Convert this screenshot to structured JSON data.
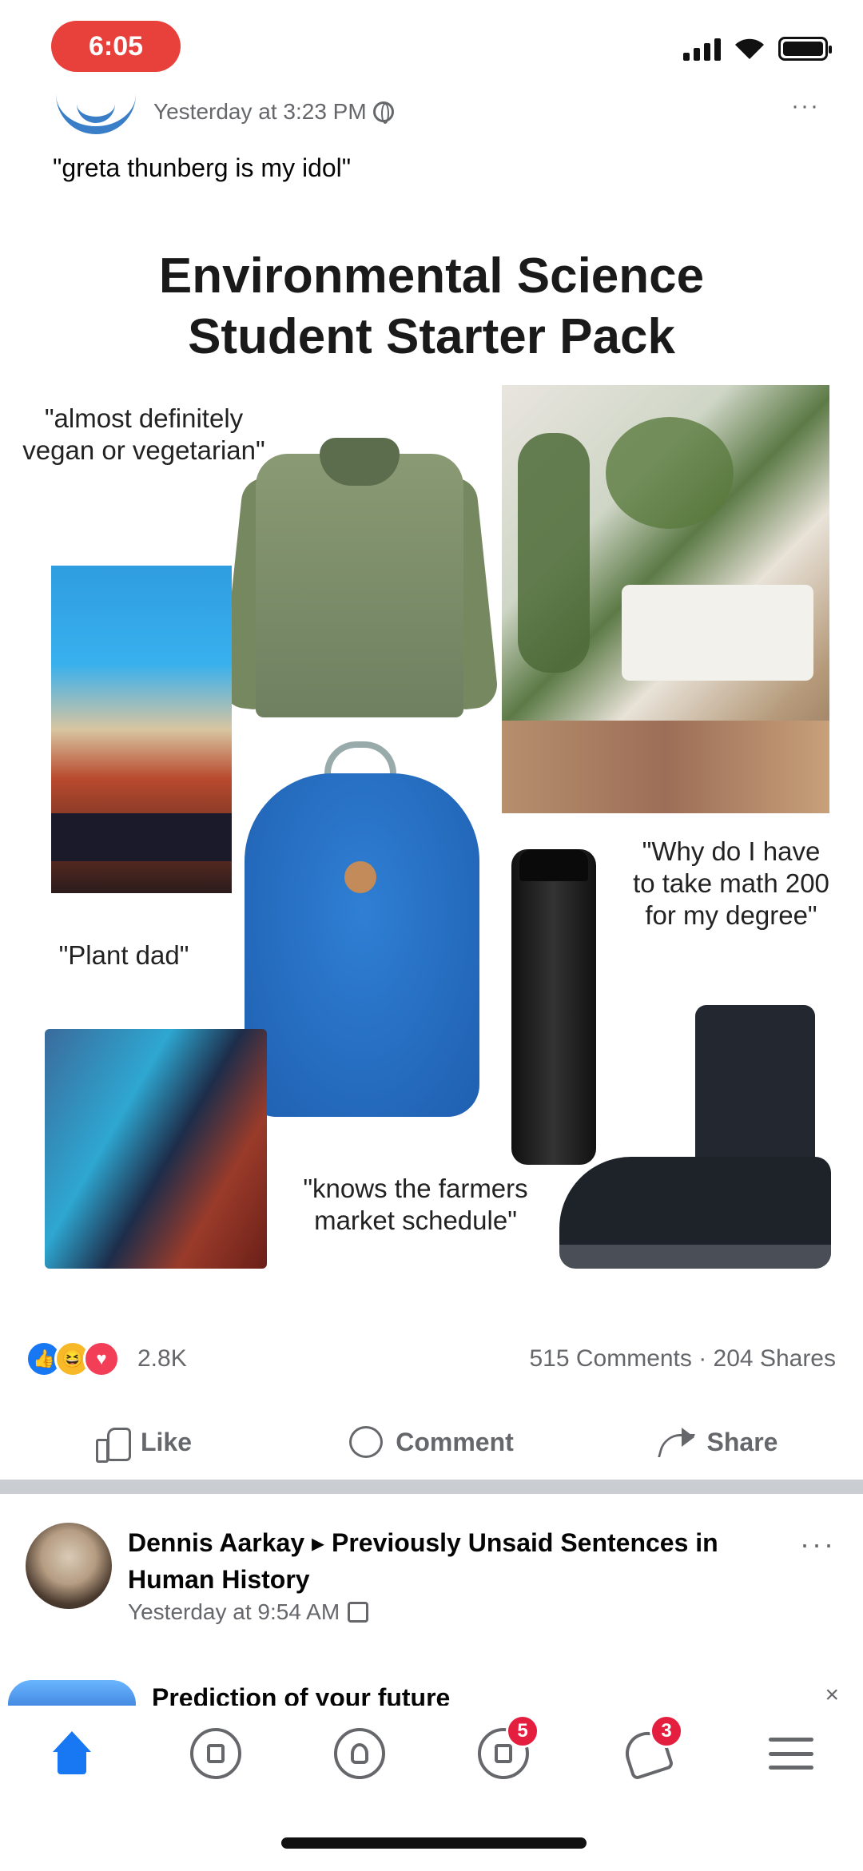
{
  "status_bar": {
    "time": "6:05"
  },
  "post": {
    "timestamp": "Yesterday at 3:23 PM",
    "caption": "\"greta thunberg is my idol\"",
    "more": "···",
    "meme": {
      "title_line1": "Environmental Science",
      "title_line2": "Student Starter Pack",
      "quote_vegan": "\"almost definitely vegan or vegetarian\"",
      "quote_plant": "\"Plant dad\"",
      "quote_math": "\"Why do I have to take math 200 for my degree\"",
      "quote_market": "\"knows the farmers market schedule\""
    },
    "reactions": {
      "count": "2.8K",
      "engagement": "515 Comments · 204 Shares"
    },
    "actions": {
      "like": "Like",
      "comment": "Comment",
      "share": "Share"
    }
  },
  "next_post": {
    "author": "Dennis Aarkay",
    "arrow": "▸",
    "group": "Previously Unsaid Sentences in Human History",
    "timestamp": "Yesterday at 9:54 AM",
    "more": "···"
  },
  "third_post": {
    "title": "Prediction of your future",
    "close": "×"
  },
  "tab_bar": {
    "notification_badge_1": "5",
    "notification_badge_2": "3"
  },
  "colors": {
    "accent": "#1877f2",
    "badge": "#e41e3f",
    "secondary_text": "#65676b"
  },
  "icons": [
    "home-icon",
    "watch-icon",
    "profile-icon",
    "groups-icon",
    "bell-icon",
    "menu-icon",
    "globe-icon",
    "like-icon",
    "comment-icon",
    "share-icon"
  ]
}
